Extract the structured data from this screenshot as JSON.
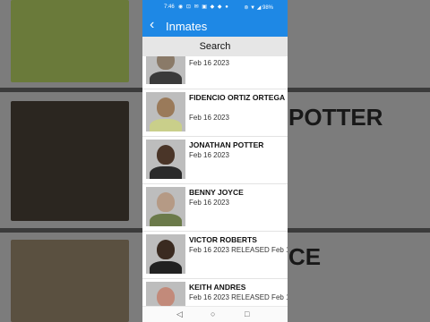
{
  "status_bar": {
    "time": "7:46",
    "icons_text": "◉ ⊡ ✉ ▣ ◆ ◆ ●",
    "battery": "⊚ ▼ ◢ 98%"
  },
  "app_bar": {
    "back_glyph": "‹",
    "title": "Inmates"
  },
  "search": {
    "label": "Search"
  },
  "inmates": [
    {
      "name": "",
      "date": "Feb 16 2023",
      "skin": "#8a7a68",
      "shirt": "#3a3a3a"
    },
    {
      "name": "FIDENCIO ORTIZ ORTEGA",
      "date": "Feb 16 2023",
      "skin": "#9a7a5a",
      "shirt": "#c9cf8a"
    },
    {
      "name": "JONATHAN POTTER",
      "date": "Feb 16 2023",
      "skin": "#4a3528",
      "shirt": "#2a2a2a"
    },
    {
      "name": "BENNY JOYCE",
      "date": "Feb 16 2023",
      "skin": "#b59a85",
      "shirt": "#6b7a4a"
    },
    {
      "name": "VICTOR ROBERTS",
      "date": "Feb 16 2023 RELEASED Feb 1",
      "skin": "#3a2a20",
      "shirt": "#222222"
    },
    {
      "name": "KEITH ANDRES",
      "date": "Feb 16 2023 RELEASED Feb 1",
      "skin": "#c28a7a",
      "shirt": "#c9cf8a"
    }
  ],
  "nav_bar": {
    "back": "◁",
    "home": "○",
    "recents": "□"
  },
  "background_text": {
    "line1": "POTTER",
    "line2": "CE"
  }
}
